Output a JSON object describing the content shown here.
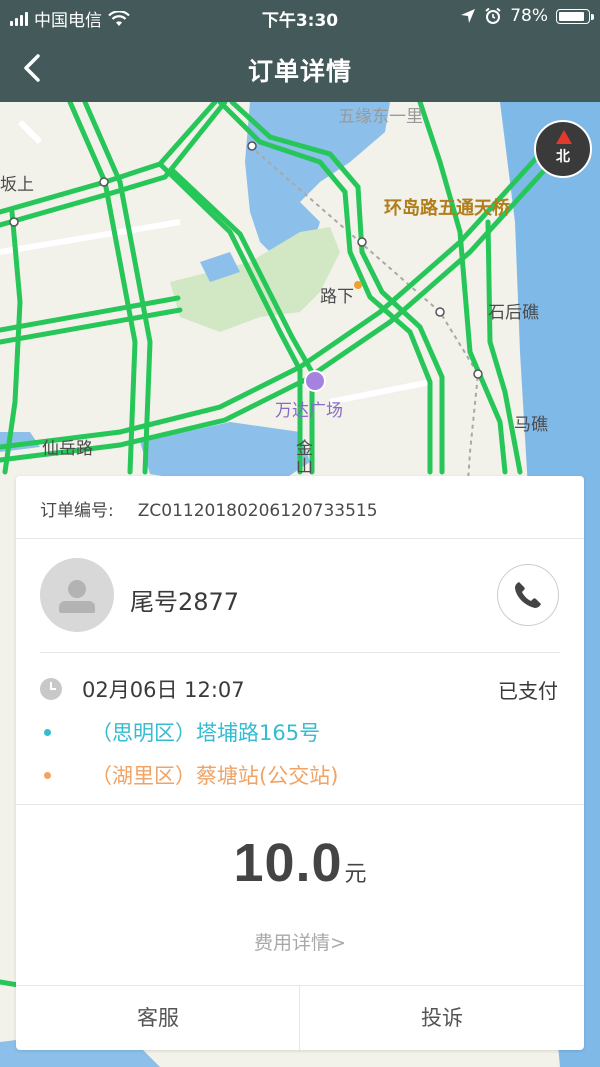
{
  "status_bar": {
    "carrier": "中国电信",
    "time": "下午3:30",
    "battery": "78%"
  },
  "nav": {
    "title": "订单详情"
  },
  "map": {
    "labels": {
      "wuyuan": "五缘东一里",
      "huandao": "环岛路五通天桥",
      "banshang": "坂上",
      "luxia": "路下",
      "shihou": "石后礁",
      "wanda": "万达广场",
      "majiao": "马礁",
      "xianyue": "仙岳路",
      "jin": "金",
      "shan": "山"
    },
    "compass_label": "北"
  },
  "order": {
    "number_label": "订单编号:",
    "number": "ZC01120180206120733515",
    "driver_name": "尾号2877",
    "datetime": "02月06日 12:07",
    "pay_status": "已支付",
    "from": "（思明区）塔埔路165号",
    "to": "（湖里区）蔡塘站(公交站)",
    "price": "10.0",
    "price_unit": "元",
    "fee_detail": "费用详情>"
  },
  "footer": {
    "service": "客服",
    "complaint": "投诉"
  }
}
